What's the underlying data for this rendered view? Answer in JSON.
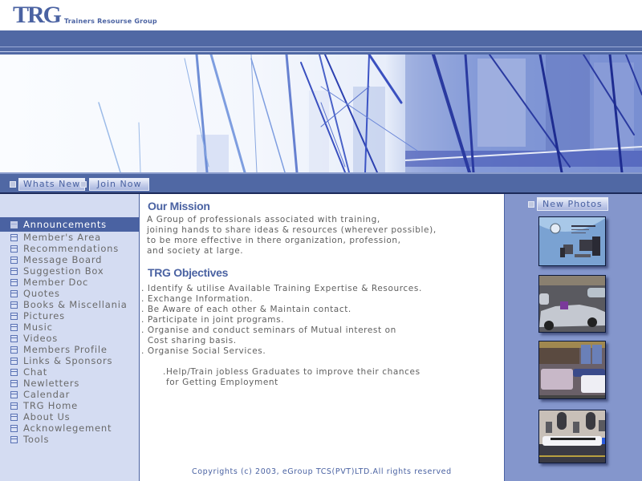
{
  "header": {
    "logo": "TRG",
    "tagline": "Trainers Resourse Group"
  },
  "navbar": {
    "buttons": [
      {
        "label": "Whats New"
      },
      {
        "label": "Join Now"
      }
    ]
  },
  "sidebar": {
    "items": [
      {
        "label": "Announcements",
        "active": true
      },
      {
        "label": "Member's Area"
      },
      {
        "label": "Recommendations"
      },
      {
        "label": "Message Board"
      },
      {
        "label": "Suggestion Box"
      },
      {
        "label": "Member Doc"
      },
      {
        "label": "Quotes"
      },
      {
        "label": "Books & Miscellania"
      },
      {
        "label": "Pictures"
      },
      {
        "label": "Music"
      },
      {
        "label": "Videos"
      },
      {
        "label": "Members Profile"
      },
      {
        "label": "Links & Sponsors"
      },
      {
        "label": "Chat"
      },
      {
        "label": "Newletters"
      },
      {
        "label": "Calendar"
      },
      {
        "label": "TRG Home"
      },
      {
        "label": "About Us"
      },
      {
        "label": "Acknowlegement"
      },
      {
        "label": "Tools"
      }
    ]
  },
  "main": {
    "mission": {
      "heading": "Our Mission",
      "text": "A Group of professionals associated with training,\njoining hands to share ideas & resources (wherever possible),\nto be more effective in there organization, profession,\nand society at large."
    },
    "objectives": {
      "heading": "TRG Objectives",
      "text": ". Identify & utilise Available Training Expertise & Resources.\n. Exchange Information.\n. Be Aware of each other & Maintain contact.\n. Participate in joint programs.\n. Organise and conduct seminars of Mutual interest on\n  Cost sharing basis.\n. Organise Social Services.",
      "extra": ".Help/Train jobless Graduates to improve their chances\n for Getting Employment"
    },
    "copyright": "Copyrights (c) 2003, eGroup TCS(PVT)LTD.All rights reserved"
  },
  "rightcol": {
    "button_label": "New Photos",
    "photos": [
      {
        "icon": "computer-ad-photo"
      },
      {
        "icon": "convertible-car-photo"
      },
      {
        "icon": "street-cars-photo"
      },
      {
        "icon": "limousine-photo"
      }
    ]
  },
  "colors": {
    "brand": "#4a62a2",
    "bar": "#5068a4",
    "sidebar_bg": "#d4dcf2",
    "rightcol_bg": "#8496cc",
    "text": "#606060"
  }
}
